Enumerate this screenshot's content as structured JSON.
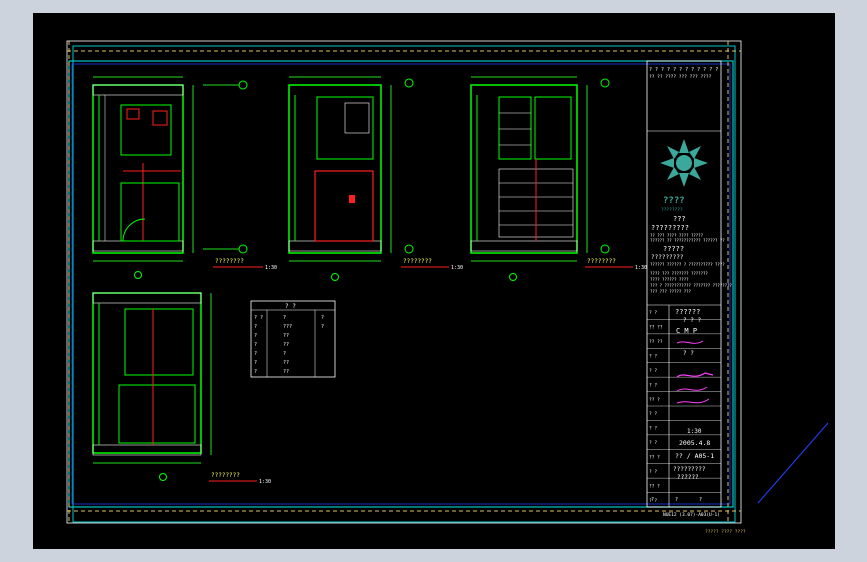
{
  "colors": {
    "background": "#cdd3dc",
    "canvas": "#000000",
    "border_cyan": "#00c8c8",
    "frame_white": "#ffffff",
    "dash_yellow": "#e0c060",
    "wall_green": "#00ff00",
    "dim_green": "#20e020",
    "accent_red": "#ff2020",
    "magenta": "#ff40ff",
    "blue_line": "#2040ff",
    "logo_teal": "#3aa89a"
  },
  "title_block": {
    "header_q": "? ? ? ? ? ? ? ? ? ? ? ?",
    "header_detail": "?? ?? ???? ??? ??? ????",
    "company_cn": "???",
    "company_line": "?????????",
    "company_en_1": "?? ??? ???? ???? ?????",
    "company_en_2": "?????? ?? ??????????? ?????? ??",
    "project_cn": "?????",
    "project_cn_2": "?????????",
    "project_en": "?????? ?????? ? ?????????? ????",
    "notes": [
      "???? ??? ??????? ???????",
      "???? ?????? ????",
      "??? ? ??????????? ??????? ????????",
      "??? ??? ????? ???"
    ],
    "field_labels": [
      "? ?",
      "?? ??",
      "?? ??",
      "? ?",
      "? ?",
      "? ?",
      "?? ?",
      "? ?",
      "? ?",
      "? ?",
      "?? ?",
      "? ?",
      "?? ?",
      "? ?"
    ],
    "drawing_title": "??????",
    "sub_title": "? ? ?",
    "stage_letters": "C  M  P",
    "design_mark": "?  ?",
    "scale": "1:30",
    "date": "2005.4.8",
    "sheet_no": "?? / A05-1",
    "drawing_name": "?????????",
    "drawing_name_2": "??????",
    "bottom_cells": [
      "?",
      "?",
      "?"
    ],
    "logo_text": "????",
    "logo_sub": "????????"
  },
  "views": [
    {
      "label": "????????",
      "scale": "1:30"
    },
    {
      "label": "????????",
      "scale": "1:30"
    },
    {
      "label": "????????",
      "scale": "1:30"
    },
    {
      "label": "????????",
      "scale": "1:30"
    }
  ],
  "legend": {
    "title": "?  ?",
    "rows": [
      {
        "a": "? ?",
        "b": "?",
        "c": "?"
      },
      {
        "a": "?",
        "b": "???",
        "c": "?"
      },
      {
        "a": "?",
        "b": "??",
        "c": ""
      },
      {
        "a": "?",
        "b": "??",
        "c": ""
      },
      {
        "a": "?",
        "b": "?",
        "c": ""
      },
      {
        "a": "?",
        "b": "??",
        "c": ""
      },
      {
        "a": "?",
        "b": "??",
        "c": ""
      }
    ]
  },
  "footer_code": "NUE12 (3.07)-A03(U-1)",
  "corner_text": "????? ???? ????"
}
